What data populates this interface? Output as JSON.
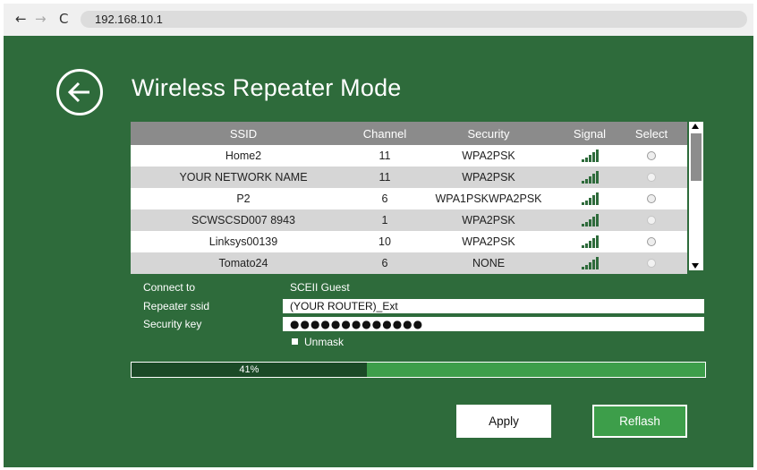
{
  "browser": {
    "url": "192.168.10.1",
    "back_glyph": "←",
    "forward_glyph": "→",
    "reload_glyph": "C"
  },
  "page": {
    "title": "Wireless Repeater Mode",
    "back_icon": "circle-arrow-left-icon"
  },
  "table": {
    "headers": {
      "ssid": "SSID",
      "channel": "Channel",
      "security": "Security",
      "signal": "Signal",
      "select": "Select"
    },
    "rows": [
      {
        "ssid": "Home2",
        "channel": "11",
        "security": "WPA2PSK"
      },
      {
        "ssid": "YOUR NETWORK NAME",
        "channel": "11",
        "security": "WPA2PSK"
      },
      {
        "ssid": "P2",
        "channel": "6",
        "security": "WPA1PSKWPA2PSK"
      },
      {
        "ssid": "SCWSCSD007 8943",
        "channel": "1",
        "security": "WPA2PSK"
      },
      {
        "ssid": "Linksys00139",
        "channel": "10",
        "security": "WPA2PSK"
      },
      {
        "ssid": "Tomato24",
        "channel": "6",
        "security": "NONE"
      }
    ]
  },
  "form": {
    "connect_to_label": "Connect to",
    "connect_to_value": "SCEII Guest",
    "repeater_ssid_label": "Repeater ssid",
    "repeater_ssid_value": "(YOUR ROUTER)_Ext",
    "security_key_label": "Security key",
    "security_key_value": "●●●●●●●●●●●●●",
    "unmask_label": "Unmask"
  },
  "progress": {
    "value": 41,
    "label": "41%"
  },
  "buttons": {
    "apply": "Apply",
    "reflash": "Reflash"
  },
  "colors": {
    "background": "#2e6b3b",
    "progress_fill": "#1b4a27",
    "progress_track": "#3d9e4a",
    "header": "#8b8b8b"
  }
}
